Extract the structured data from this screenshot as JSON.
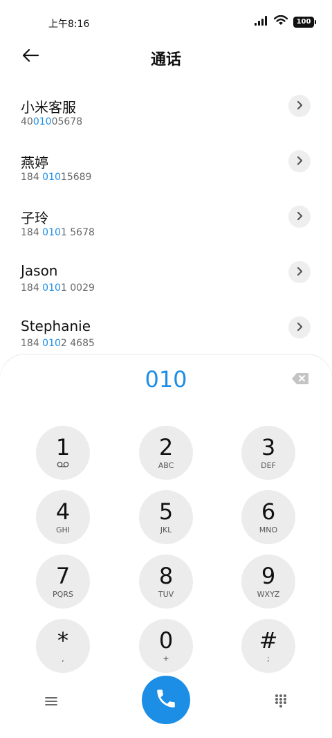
{
  "status_bar": {
    "time": "上午8:16",
    "battery": "100",
    "icons": [
      "signal-icon",
      "wifi-icon",
      "battery-icon"
    ]
  },
  "header": {
    "title": "通话",
    "back_icon": "back-arrow-icon"
  },
  "results": [
    {
      "name": "小米客服",
      "number_parts": [
        "40",
        "010",
        "05678"
      ]
    },
    {
      "name": "燕婷",
      "number_parts": [
        "184 ",
        "010",
        "15689"
      ]
    },
    {
      "name": "子玲",
      "number_parts": [
        "184 ",
        "010",
        "1 5678"
      ]
    },
    {
      "name": "Jason",
      "number_parts": [
        "184 ",
        "010",
        "1 0029"
      ]
    },
    {
      "name": "Stephanie",
      "number_parts": [
        "184 ",
        "010",
        "2 4685"
      ]
    }
  ],
  "dialpad": {
    "number": "010",
    "keys": [
      {
        "digit": "1",
        "letters": ""
      },
      {
        "digit": "2",
        "letters": "ABC"
      },
      {
        "digit": "3",
        "letters": "DEF"
      },
      {
        "digit": "4",
        "letters": "GHI"
      },
      {
        "digit": "5",
        "letters": "JKL"
      },
      {
        "digit": "6",
        "letters": "MNO"
      },
      {
        "digit": "7",
        "letters": "PQRS"
      },
      {
        "digit": "8",
        "letters": "TUV"
      },
      {
        "digit": "9",
        "letters": "WXYZ"
      },
      {
        "digit": "*",
        "letters": ","
      },
      {
        "digit": "0",
        "letters": "+"
      },
      {
        "digit": "#",
        "letters": ";"
      }
    ]
  },
  "colors": {
    "accent": "#1d8ee6",
    "key_background": "#ececec",
    "detail_button_background": "#eeeeee"
  }
}
